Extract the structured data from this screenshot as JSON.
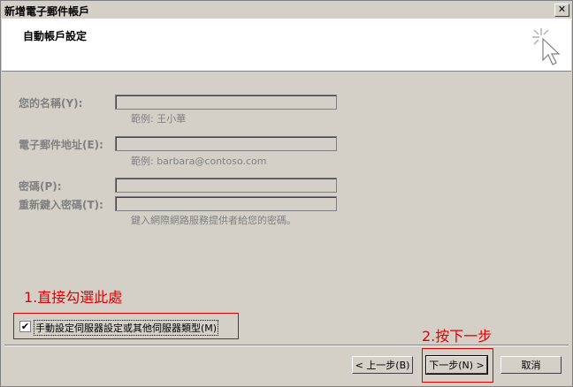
{
  "window": {
    "title": "新增電子郵件帳戶",
    "close_glyph": "✕"
  },
  "header": {
    "title": "自動帳戶設定",
    "icon": "wizard-cursor-icon"
  },
  "form": {
    "name_label": "您的名稱(Y):",
    "name_value": "",
    "name_hint": "範例: 王小華",
    "email_label": "電子郵件地址(E):",
    "email_value": "",
    "email_hint": "範例: barbara@contoso.com",
    "password_label": "密碼(P):",
    "password_value": "",
    "retype_label": "重新鍵入密碼(T):",
    "retype_value": "",
    "password_hint": "鍵入網際網路服務提供者給您的密碼。"
  },
  "manual_setup": {
    "checked": true,
    "check_glyph": "✔",
    "label": "手動設定伺服器設定或其他伺服器類型(M)"
  },
  "annotations": {
    "step1": "1.直接勾選此處",
    "step2": "2.按下一步",
    "color": "#e00000"
  },
  "buttons": {
    "back": "< 上一步(B)",
    "next": "下一步(N) >",
    "cancel": "取消"
  }
}
